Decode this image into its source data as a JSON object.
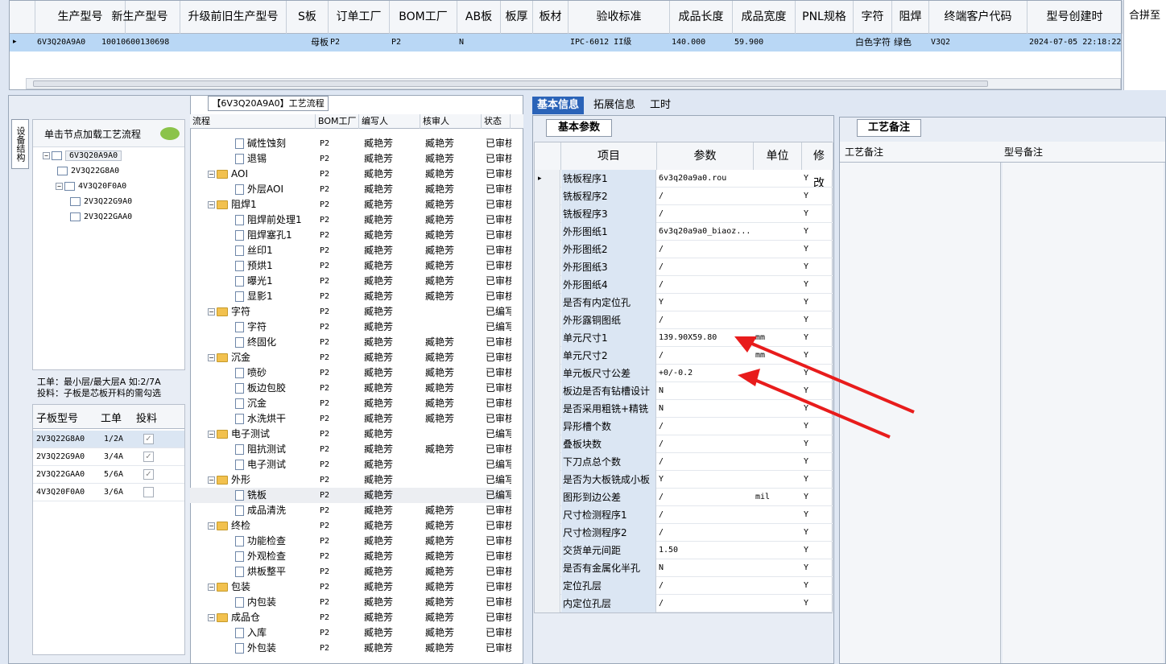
{
  "top_grid": {
    "columns": [
      "生产型号",
      "新生产型号",
      "升级前旧生产型号",
      "S板",
      "订单工厂",
      "BOM工厂",
      "AB板",
      "板厚",
      "板材",
      "验收标准",
      "成品长度",
      "成品宽度",
      "PNL规格",
      "字符",
      "阻焊",
      "终端客户代码",
      "型号创建时"
    ],
    "row": [
      "6V3Q20A9A0",
      "10010600130698",
      "",
      "母板",
      "P2",
      "P2",
      "N",
      "",
      "",
      "IPC-6012 II级",
      "140.000",
      "59.900",
      "",
      "白色字符",
      "绿色",
      "V3Q2",
      "2024-07-05 22:18:22"
    ],
    "merge_label": "合拼至"
  },
  "left": {
    "vertical_tab": "设备结构",
    "load_hint": "单击节点加载工艺流程",
    "tree": [
      {
        "label": "6V3Q20A9A0",
        "level": 0
      },
      {
        "label": "2V3Q22G8A0",
        "level": 1
      },
      {
        "label": "4V3Q20F0A0",
        "level": 1
      },
      {
        "label": "2V3Q22G9A0",
        "level": 2
      },
      {
        "label": "2V3Q22GAA0",
        "level": 2
      }
    ],
    "note1": "工单：最小层/最大层A 如:2/7A",
    "note2": "投料：子板是芯板开料的需勾选",
    "sub_headers": [
      "子板型号",
      "工单",
      "投料"
    ],
    "sub_rows": [
      {
        "model": "2V3Q22G8A0",
        "order": "1/2A",
        "checked": true
      },
      {
        "model": "2V3Q22G9A0",
        "order": "3/4A",
        "checked": true
      },
      {
        "model": "2V3Q22GAA0",
        "order": "5/6A",
        "checked": true
      },
      {
        "model": "4V3Q20F0A0",
        "order": "3/6A",
        "checked": false
      }
    ]
  },
  "process": {
    "title": "【6V3Q20A9A0】工艺流程",
    "headers": [
      "流程",
      "BOM工厂",
      "编写人",
      "核审人",
      "状态"
    ],
    "rows": [
      {
        "name": "碱性蚀刻",
        "type": "doc",
        "bom": "P2",
        "writer": "臧艳芳",
        "checker": "臧艳芳",
        "status": "已审核"
      },
      {
        "name": "退锡",
        "type": "doc",
        "bom": "P2",
        "writer": "臧艳芳",
        "checker": "臧艳芳",
        "status": "已审核"
      },
      {
        "name": "AOI",
        "type": "folder",
        "bom": "P2",
        "writer": "臧艳芳",
        "checker": "臧艳芳",
        "status": "已审核"
      },
      {
        "name": "外层AOI",
        "type": "doc",
        "bom": "P2",
        "writer": "臧艳芳",
        "checker": "臧艳芳",
        "status": "已审核"
      },
      {
        "name": "阻焊1",
        "type": "folder",
        "bom": "P2",
        "writer": "臧艳芳",
        "checker": "臧艳芳",
        "status": "已审核"
      },
      {
        "name": "阻焊前处理1",
        "type": "doc",
        "bom": "P2",
        "writer": "臧艳芳",
        "checker": "臧艳芳",
        "status": "已审核"
      },
      {
        "name": "阻焊塞孔1",
        "type": "doc",
        "bom": "P2",
        "writer": "臧艳芳",
        "checker": "臧艳芳",
        "status": "已审核"
      },
      {
        "name": "丝印1",
        "type": "doc",
        "bom": "P2",
        "writer": "臧艳芳",
        "checker": "臧艳芳",
        "status": "已审核"
      },
      {
        "name": "预烘1",
        "type": "doc",
        "bom": "P2",
        "writer": "臧艳芳",
        "checker": "臧艳芳",
        "status": "已审核"
      },
      {
        "name": "曝光1",
        "type": "doc",
        "bom": "P2",
        "writer": "臧艳芳",
        "checker": "臧艳芳",
        "status": "已审核"
      },
      {
        "name": "显影1",
        "type": "doc",
        "bom": "P2",
        "writer": "臧艳芳",
        "checker": "臧艳芳",
        "status": "已审核"
      },
      {
        "name": "字符",
        "type": "folder",
        "bom": "P2",
        "writer": "臧艳芳",
        "checker": "",
        "status": "已编写"
      },
      {
        "name": "字符",
        "type": "doc",
        "bom": "P2",
        "writer": "臧艳芳",
        "checker": "",
        "status": "已编写"
      },
      {
        "name": "终固化",
        "type": "doc",
        "bom": "P2",
        "writer": "臧艳芳",
        "checker": "臧艳芳",
        "status": "已审核"
      },
      {
        "name": "沉金",
        "type": "folder",
        "bom": "P2",
        "writer": "臧艳芳",
        "checker": "臧艳芳",
        "status": "已审核"
      },
      {
        "name": "喷砂",
        "type": "doc",
        "bom": "P2",
        "writer": "臧艳芳",
        "checker": "臧艳芳",
        "status": "已审核"
      },
      {
        "name": "板边包胶",
        "type": "doc",
        "bom": "P2",
        "writer": "臧艳芳",
        "checker": "臧艳芳",
        "status": "已审核"
      },
      {
        "name": "沉金",
        "type": "doc",
        "bom": "P2",
        "writer": "臧艳芳",
        "checker": "臧艳芳",
        "status": "已审核"
      },
      {
        "name": "水洗烘干",
        "type": "doc",
        "bom": "P2",
        "writer": "臧艳芳",
        "checker": "臧艳芳",
        "status": "已审核"
      },
      {
        "name": "电子测试",
        "type": "folder",
        "bom": "P2",
        "writer": "臧艳芳",
        "checker": "",
        "status": "已编写"
      },
      {
        "name": "阻抗测试",
        "type": "doc",
        "bom": "P2",
        "writer": "臧艳芳",
        "checker": "臧艳芳",
        "status": "已审核"
      },
      {
        "name": "电子测试",
        "type": "doc",
        "bom": "P2",
        "writer": "臧艳芳",
        "checker": "",
        "status": "已编写"
      },
      {
        "name": "外形",
        "type": "folder",
        "bom": "P2",
        "writer": "臧艳芳",
        "checker": "",
        "status": "已编写"
      },
      {
        "name": "铣板",
        "type": "doc",
        "bom": "P2",
        "writer": "臧艳芳",
        "checker": "",
        "status": "已编写"
      },
      {
        "name": "成品清洗",
        "type": "doc",
        "bom": "P2",
        "writer": "臧艳芳",
        "checker": "臧艳芳",
        "status": "已审核"
      },
      {
        "name": "终检",
        "type": "folder",
        "bom": "P2",
        "writer": "臧艳芳",
        "checker": "臧艳芳",
        "status": "已审核"
      },
      {
        "name": "功能检查",
        "type": "doc",
        "bom": "P2",
        "writer": "臧艳芳",
        "checker": "臧艳芳",
        "status": "已审核"
      },
      {
        "name": "外观检查",
        "type": "doc",
        "bom": "P2",
        "writer": "臧艳芳",
        "checker": "臧艳芳",
        "status": "已审核"
      },
      {
        "name": "烘板整平",
        "type": "doc",
        "bom": "P2",
        "writer": "臧艳芳",
        "checker": "臧艳芳",
        "status": "已审核"
      },
      {
        "name": "包装",
        "type": "folder",
        "bom": "P2",
        "writer": "臧艳芳",
        "checker": "臧艳芳",
        "status": "已审核"
      },
      {
        "name": "内包装",
        "type": "doc",
        "bom": "P2",
        "writer": "臧艳芳",
        "checker": "臧艳芳",
        "status": "已审核"
      },
      {
        "name": "成品仓",
        "type": "folder",
        "bom": "P2",
        "writer": "臧艳芳",
        "checker": "臧艳芳",
        "status": "已审核"
      },
      {
        "name": "入库",
        "type": "doc",
        "bom": "P2",
        "writer": "臧艳芳",
        "checker": "臧艳芳",
        "status": "已审核"
      },
      {
        "name": "外包装",
        "type": "doc",
        "bom": "P2",
        "writer": "臧艳芳",
        "checker": "臧艳芳",
        "status": "已审核"
      }
    ]
  },
  "info": {
    "tabs": [
      "基本信息",
      "拓展信息",
      "工时"
    ],
    "param_tab": "基本参数",
    "headers": [
      "项目",
      "参数",
      "单位",
      "修改"
    ],
    "rows": [
      {
        "item": "铣板程序1",
        "param": "6v3q20a9a0.rou",
        "unit": "",
        "mod": "Y"
      },
      {
        "item": "铣板程序2",
        "param": "/",
        "unit": "",
        "mod": "Y"
      },
      {
        "item": "铣板程序3",
        "param": "/",
        "unit": "",
        "mod": "Y"
      },
      {
        "item": "外形图纸1",
        "param": "6v3q20a9a0_biaoz...",
        "unit": "",
        "mod": "Y"
      },
      {
        "item": "外形图纸2",
        "param": "/",
        "unit": "",
        "mod": "Y"
      },
      {
        "item": "外形图纸3",
        "param": "/",
        "unit": "",
        "mod": "Y"
      },
      {
        "item": "外形图纸4",
        "param": "/",
        "unit": "",
        "mod": "Y"
      },
      {
        "item": "是否有内定位孔",
        "param": "Y",
        "unit": "",
        "mod": "Y"
      },
      {
        "item": "外形露铜图纸",
        "param": "/",
        "unit": "",
        "mod": "Y"
      },
      {
        "item": "单元尺寸1",
        "param": "139.90X59.80",
        "unit": "mm",
        "mod": "Y"
      },
      {
        "item": "单元尺寸2",
        "param": "/",
        "unit": "mm",
        "mod": "Y"
      },
      {
        "item": "单元板尺寸公差",
        "param": "+0/-0.2",
        "unit": "",
        "mod": "Y"
      },
      {
        "item": "板边是否有钻槽设计",
        "param": "N",
        "unit": "",
        "mod": "Y"
      },
      {
        "item": "是否采用粗铣+精铣",
        "param": "N",
        "unit": "",
        "mod": "Y"
      },
      {
        "item": "异形槽个数",
        "param": "/",
        "unit": "",
        "mod": "Y"
      },
      {
        "item": "叠板块数",
        "param": "/",
        "unit": "",
        "mod": "Y"
      },
      {
        "item": "下刀点总个数",
        "param": "/",
        "unit": "",
        "mod": "Y"
      },
      {
        "item": "是否为大板铣成小板",
        "param": "Y",
        "unit": "",
        "mod": "Y"
      },
      {
        "item": "图形到边公差",
        "param": "/",
        "unit": "mil",
        "mod": "Y"
      },
      {
        "item": "尺寸检测程序1",
        "param": "/",
        "unit": "",
        "mod": "Y"
      },
      {
        "item": "尺寸检测程序2",
        "param": "/",
        "unit": "",
        "mod": "Y"
      },
      {
        "item": "交货单元间距",
        "param": "1.50",
        "unit": "",
        "mod": "Y"
      },
      {
        "item": "是否有金属化半孔",
        "param": "N",
        "unit": "",
        "mod": "Y"
      },
      {
        "item": "定位孔层",
        "param": "/",
        "unit": "",
        "mod": "Y"
      },
      {
        "item": "内定位孔层",
        "param": "/",
        "unit": "",
        "mod": "Y"
      }
    ],
    "remark_tab": "工艺备注",
    "remark_headers": [
      "工艺备注",
      "型号备注"
    ]
  },
  "colors": {
    "selection": "#b9d7f5",
    "arrow": "#e81c1c",
    "accent_tab": "#2a63b8"
  }
}
